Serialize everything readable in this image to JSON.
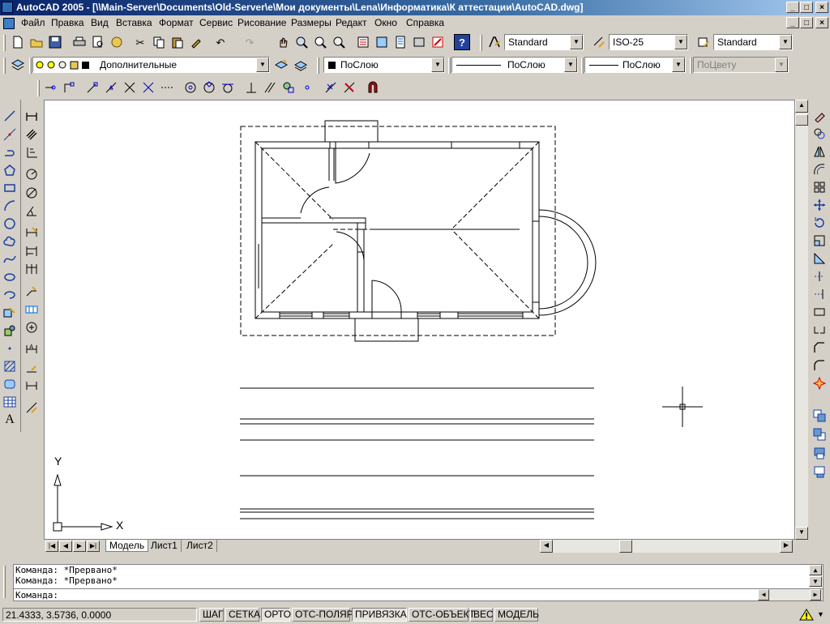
{
  "window": {
    "title": "AutoCAD 2005 - [\\\\Main-Server\\Documents\\Old-Server\\e\\Мои документы\\Lena\\Информатика\\К аттестации\\AutoCAD.dwg]",
    "controls": [
      "_",
      "□",
      "×"
    ]
  },
  "menu": {
    "items": [
      "Файл",
      "Правка",
      "Вид",
      "Вставка",
      "Формат",
      "Сервис",
      "Рисование",
      "Размеры",
      "Редакт",
      "Окно",
      "Справка"
    ],
    "doc_controls": [
      "_",
      "□",
      "×"
    ]
  },
  "toolbar_standard": {
    "text_style": "Standard",
    "dim_style": "ISO-25",
    "table_style": "Standard"
  },
  "toolbar_layers": {
    "layer": "Дополнительные",
    "color": "ПоСлою",
    "linetype": "ПоСлою",
    "lineweight": "ПоСлою",
    "plotstyle": "ПоЦвету"
  },
  "ucs": {
    "x_label": "X",
    "y_label": "Y"
  },
  "tabs": [
    "Модель",
    "Лист1",
    "Лист2"
  ],
  "command_window": {
    "lines": [
      "Команда: *Прервано*",
      "Команда: *Прервано*"
    ],
    "prompt": "Команда:"
  },
  "status": {
    "coords": "21.4333, 3.5736, 0.0000",
    "buttons": [
      {
        "label": "ШАГ",
        "on": false
      },
      {
        "label": "СЕТКА",
        "on": false
      },
      {
        "label": "ОРТО",
        "on": true
      },
      {
        "label": "ОТС-ПОЛЯР",
        "on": false
      },
      {
        "label": "ПРИВЯЗКА",
        "on": true
      },
      {
        "label": "ОТС-ОБЪЕКТ",
        "on": false
      },
      {
        "label": "ВЕС",
        "on": false
      },
      {
        "label": "МОДЕЛЬ",
        "on": false
      }
    ]
  }
}
